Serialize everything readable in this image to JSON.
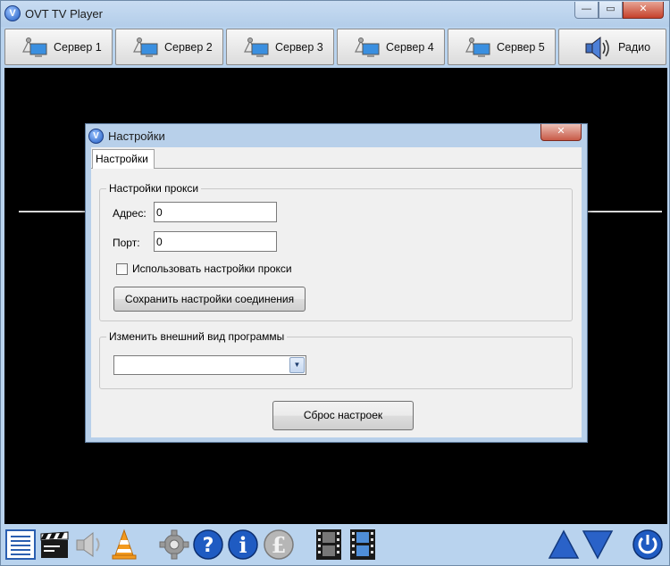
{
  "app": {
    "title": "OVT TV Player",
    "icon": "ovt-logo-icon",
    "logo_letter": "V"
  },
  "window_controls": {
    "minimize": "—",
    "maximize": "▭",
    "close": "✕"
  },
  "server_bar": [
    {
      "label": "Сервер 1",
      "icon": "server-monitor-icon"
    },
    {
      "label": "Сервер 2",
      "icon": "server-monitor-icon"
    },
    {
      "label": "Сервер 3",
      "icon": "server-monitor-icon"
    },
    {
      "label": "Сервер 4",
      "icon": "server-monitor-icon"
    },
    {
      "label": "Сервер 5",
      "icon": "server-monitor-icon"
    },
    {
      "label": "Радио",
      "icon": "radio-speaker-icon"
    }
  ],
  "dialog": {
    "title": "Настройки",
    "close": "✕",
    "tab": "Настройки",
    "proxy_group": {
      "legend": "Настройки прокси",
      "address_label": "Адрес:",
      "address_value": "0",
      "port_label": "Порт:",
      "port_value": "0",
      "use_proxy_label": "Использовать настройки прокси",
      "use_proxy_checked": false,
      "save_button": "Сохранить настройки соединения"
    },
    "appearance_group": {
      "legend": "Изменить внешний вид программы",
      "selected_value": "",
      "arrow": "▼"
    },
    "reset_button": "Сброс настроек"
  },
  "bottom_toolbar": [
    "playlist-icon",
    "clapperboard-icon",
    "volume-icon",
    "vlc-cone-icon",
    "settings-gear-icon",
    "help-question-icon",
    "info-icon",
    "pound-donate-icon",
    "film-strip-icon",
    "film-strip-alt-icon",
    "arrow-up-icon",
    "arrow-down-icon",
    "power-icon"
  ],
  "colors": {
    "window_frame": "#b9d3ee",
    "video_bg": "#000000",
    "dialog_frame": "#b8d0ea",
    "close_red": "#c5412b",
    "toolbar_blue": "#1f5bc2"
  },
  "help_glyph": "?",
  "info_glyph": "i",
  "pound_glyph": "£"
}
